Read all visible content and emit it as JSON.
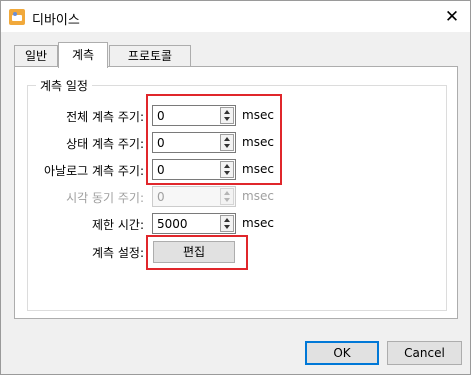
{
  "window": {
    "title": "디바이스",
    "icons": {
      "app": "device-app-icon",
      "close": "close-icon"
    },
    "close_glyph": "✕"
  },
  "tabs": [
    {
      "label": "일반",
      "active": false
    },
    {
      "label": "계측",
      "active": true
    },
    {
      "label": "프로토콜",
      "active": false
    }
  ],
  "group": {
    "title": "계측 일정",
    "rows": [
      {
        "label": "전체 계측 주기:",
        "value": "0",
        "unit": "msec",
        "disabled": false
      },
      {
        "label": "상태 계측 주기:",
        "value": "0",
        "unit": "msec",
        "disabled": false
      },
      {
        "label": "아날로그 계측 주기:",
        "value": "0",
        "unit": "msec",
        "disabled": false
      },
      {
        "label": "시각 동기 주기:",
        "value": "0",
        "unit": "msec",
        "disabled": true
      },
      {
        "label": "제한 시간:",
        "value": "5000",
        "unit": "msec",
        "disabled": false
      }
    ],
    "settings": {
      "label": "계측 설정:",
      "button_label": "편집"
    }
  },
  "footer": {
    "ok_label": "OK",
    "cancel_label": "Cancel"
  },
  "colors": {
    "highlight": "#e0262b",
    "window_bg": "#f0f0f0",
    "accent": "#0078d7"
  }
}
